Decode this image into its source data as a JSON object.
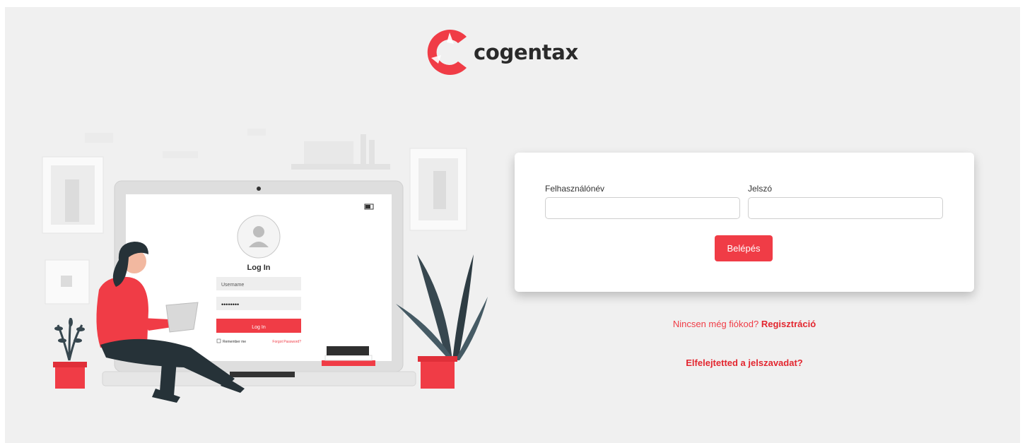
{
  "brand": {
    "name": "cogentax",
    "accent_color": "#f03c46"
  },
  "illustration": {
    "screen_title": "Log In",
    "username_placeholder": "Username",
    "password_mask": "••••••••",
    "login_button": "Log In",
    "remember_me": "Remember me",
    "forgot_password": "Forgot Password?"
  },
  "form": {
    "username_label": "Felhasználónév",
    "username_value": "",
    "password_label": "Jelszó",
    "password_value": "",
    "submit_label": "Belépés"
  },
  "links": {
    "no_account_text": "Nincsen még fiókod?",
    "register_label": "Regisztráció",
    "forgot_label": "Elfelejtetted a jelszavadat?"
  }
}
